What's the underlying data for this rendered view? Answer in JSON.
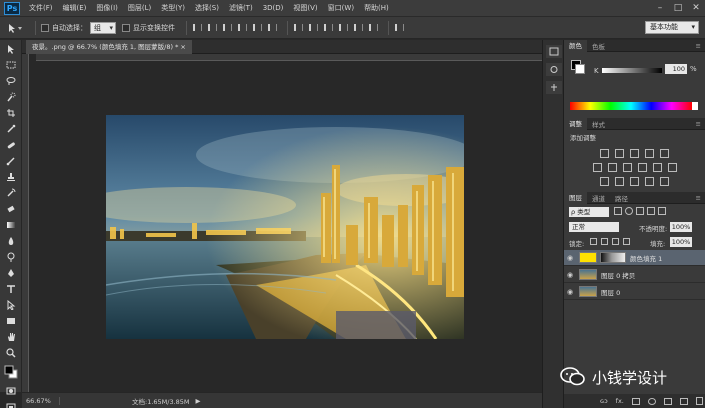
{
  "app": {
    "logo": "Ps"
  },
  "menu": [
    "文件(F)",
    "编辑(E)",
    "图像(I)",
    "图层(L)",
    "类型(Y)",
    "选择(S)",
    "滤镜(T)",
    "3D(D)",
    "视图(V)",
    "窗口(W)",
    "帮助(H)"
  ],
  "window_buttons": [
    "–",
    "□",
    "✕"
  ],
  "options": {
    "auto_select_label": "自动选择：",
    "auto_select_value": "组",
    "show_transform_label": "显示变换控件",
    "workspace": "基本功能"
  },
  "document": {
    "tab_title": "夜景。.png @ 66.7% (颜色填充 1, 图层蒙版/8) * ×"
  },
  "status": {
    "zoom": "66.67%",
    "doc_info": "文档:1.65M/3.85M",
    "arrow": "▶"
  },
  "color_panel": {
    "tabs": [
      "颜色",
      "色板"
    ],
    "channel_label": "K",
    "value": "100",
    "unit": "%"
  },
  "adjust_panel": {
    "tabs": [
      "调整",
      "样式"
    ],
    "title": "添加调整"
  },
  "layers_panel": {
    "tabs": [
      "图层",
      "通道",
      "路径"
    ],
    "kind_filter": "ρ 类型",
    "blend_mode": "正常",
    "opacity_label": "不透明度:",
    "opacity_value": "100%",
    "lock_label": "锁定:",
    "fill_label": "填充:",
    "fill_value": "100%",
    "layers": [
      {
        "name": "颜色填充 1",
        "selected": true
      },
      {
        "name": "图层 0 拷贝",
        "selected": false
      },
      {
        "name": "图层 0",
        "selected": false
      }
    ],
    "bottom_icons": [
      "ɢɔ",
      "fx."
    ]
  },
  "watermark": {
    "text": "小钱学设计"
  },
  "colors": {
    "accent": "#31a8ff",
    "selected_layer": "#5a6470",
    "fill_swatch": "#ffe100"
  }
}
